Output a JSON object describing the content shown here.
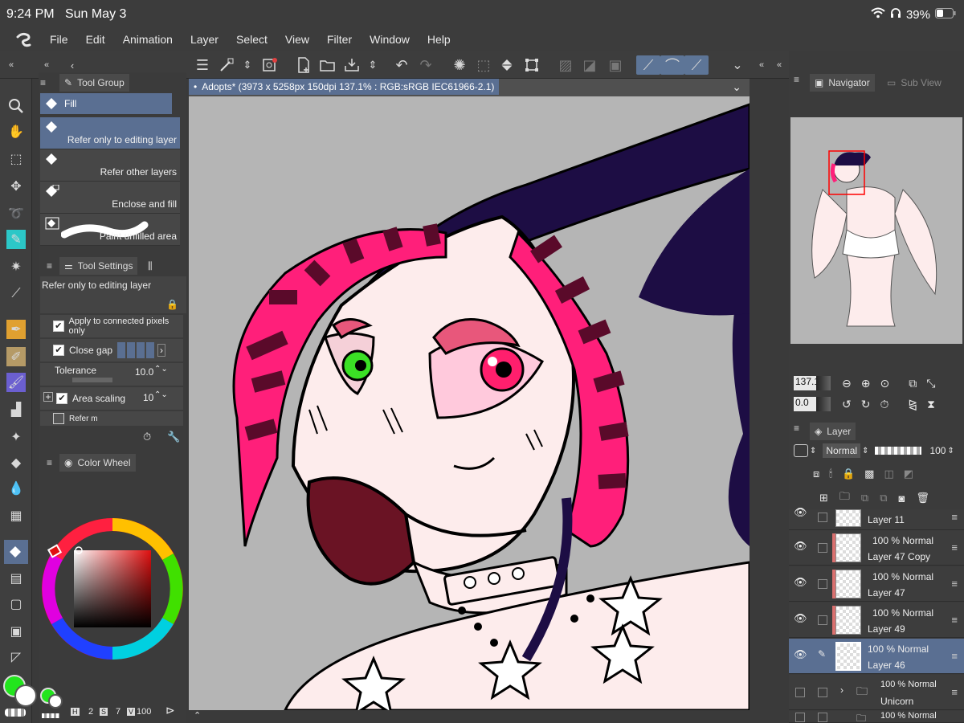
{
  "status": {
    "time": "9:24 PM",
    "date": "Sun May 3",
    "battery": "39%"
  },
  "menu": [
    "File",
    "Edit",
    "Animation",
    "Layer",
    "Select",
    "View",
    "Filter",
    "Window",
    "Help"
  ],
  "tool_group": {
    "tab": "Tool Group",
    "header": "Fill",
    "items": [
      "Refer only to editing layer",
      "Refer other layers",
      "Enclose and fill",
      "Paint unfilled area"
    ]
  },
  "tool_settings": {
    "tab": "Tool Settings",
    "preset": "Refer only to editing layer",
    "apply_connected": "Apply to connected pixels only",
    "close_gap": "Close gap",
    "tolerance_label": "Tolerance",
    "tolerance_value": "10.0",
    "area_scaling_label": "Area scaling",
    "area_scaling_value": "10",
    "refer_truncated": "Refer m"
  },
  "color_wheel": {
    "tab": "Color Wheel"
  },
  "footer": {
    "h": "H",
    "size": "2",
    "s": "S",
    "seven": "7",
    "v": "V",
    "hundred": "100"
  },
  "document": {
    "title": "Adopts* (3973 x 5258px 150dpi 137.1% : RGB:sRGB IEC61966-2.1)"
  },
  "navigator": {
    "tab": "Navigator",
    "sub_tab": "Sub View",
    "zoom": "137.1",
    "rotation": "0.0"
  },
  "layer_panel": {
    "tab": "Layer",
    "blend_mode": "Normal",
    "opacity": "100",
    "layers": [
      {
        "mode": "",
        "name": "Layer 11"
      },
      {
        "mode": "100 %  Normal",
        "name": "Layer 47 Copy"
      },
      {
        "mode": "100 %  Normal",
        "name": "Layer 47"
      },
      {
        "mode": "100 %  Normal",
        "name": "Layer 49"
      },
      {
        "mode": "100 %  Normal",
        "name": "Layer 46"
      },
      {
        "mode": "100 %  Normal",
        "name": "Unicorn"
      },
      {
        "mode": "100 %  Normal",
        "name": ""
      }
    ]
  },
  "colors": {
    "accent": "#5a6f92",
    "main_color": "#22e51d",
    "sub_color": "#ffffff"
  }
}
